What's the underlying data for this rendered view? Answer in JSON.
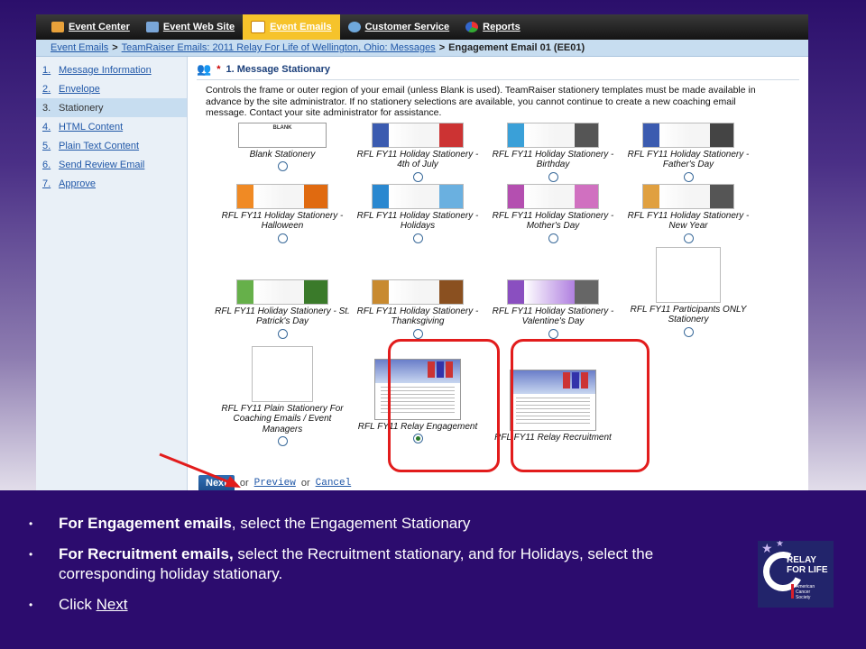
{
  "topnav": {
    "items": [
      {
        "label": "Event Center",
        "icon": "house-icon"
      },
      {
        "label": "Event Web Site",
        "icon": "web-icon"
      },
      {
        "label": "Event Emails",
        "icon": "mail-icon",
        "active": true
      },
      {
        "label": "Customer Service",
        "icon": "people-icon"
      },
      {
        "label": "Reports",
        "icon": "chart-icon"
      }
    ]
  },
  "breadcrumb": {
    "link1": "Event Emails",
    "link2": "TeamRaiser Emails: 2011 Relay For Life of Wellington, Ohio: Messages",
    "sep": ">",
    "current": "Engagement Email 01 (EE01)"
  },
  "sidebar": {
    "steps": [
      {
        "num": "1.",
        "label": "Message Information"
      },
      {
        "num": "2.",
        "label": "Envelope"
      },
      {
        "num": "3.",
        "label": "Stationery",
        "current": true
      },
      {
        "num": "4.",
        "label": "HTML Content"
      },
      {
        "num": "5.",
        "label": "Plain Text Content"
      },
      {
        "num": "6.",
        "label": "Send Review Email"
      },
      {
        "num": "7.",
        "label": "Approve"
      }
    ]
  },
  "section": {
    "star": "*",
    "title": "1.  Message Stationary",
    "description": "Controls the frame or outer region of your email (unless Blank is used). TeamRaiser stationery templates must be made available in advance by the site administrator. If no stationery selections are available, you cannot continue to create a new coaching email message. Contact your site administrator for assistance."
  },
  "stationery": {
    "blank_thumb_text": "BLANK",
    "items": [
      {
        "label": "Blank Stationery"
      },
      {
        "label": "RFL FY11 Holiday Stationery - 4th of July"
      },
      {
        "label": "RFL FY11 Holiday Stationery - Birthday"
      },
      {
        "label": "RFL FY11 Holiday Stationery - Father's Day"
      },
      {
        "label": "RFL FY11 Holiday Stationery - Halloween"
      },
      {
        "label": "RFL FY11 Holiday Stationery - Holidays"
      },
      {
        "label": "RFL FY11 Holiday Stationery - Mother's Day"
      },
      {
        "label": "RFL FY11 Holiday Stationery - New Year"
      },
      {
        "label": "RFL FY11 Holiday Stationery - St. Patrick's Day"
      },
      {
        "label": "RFL FY11 Holiday Stationery - Thanksgiving"
      },
      {
        "label": "RFL FY11 Holiday Stationery - Valentine's Day"
      },
      {
        "label": "RFL FY11 Participants ONLY Stationery"
      },
      {
        "label": "RFL FY11 Plain Stationery For Coaching Emails / Event Managers"
      },
      {
        "label": "RFL FY11 Relay Engagement",
        "selected": true
      },
      {
        "label": "RFL FY11 Relay Recruitment"
      }
    ]
  },
  "actions": {
    "next": "Next",
    "or1": "or",
    "preview": "Preview",
    "or2": "or",
    "cancel": "Cancel"
  },
  "instructions": {
    "b1_bold": "For Engagement emails",
    "b1_rest": ", select the Engagement Stationary",
    "b2_bold": "For Recruitment emails,",
    "b2_rest": " select the Recruitment stationary, and for Holidays, select the corresponding holiday stationary.",
    "b3_prefix": "Click ",
    "b3_link": "Next"
  },
  "logo": {
    "line1": "RELAY",
    "line2": "FOR LIFE",
    "org1": "American",
    "org2": "Cancer",
    "org3": "Society"
  },
  "colors": {
    "highlight": "#e21c1c",
    "nav_active": "#f6c32b",
    "bottom_panel": "#2c0c6e"
  }
}
